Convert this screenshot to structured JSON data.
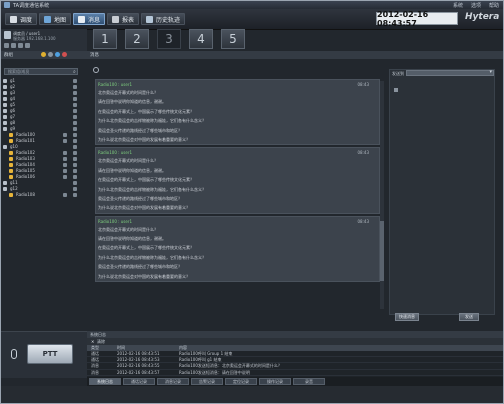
{
  "window": {
    "title": "TA调度通信系统",
    "controls": [
      "系统",
      "选项",
      "帮助"
    ]
  },
  "toolbar": {
    "buttons": [
      {
        "label": "调度"
      },
      {
        "label": "地图"
      },
      {
        "label": "消息"
      },
      {
        "label": "报表"
      },
      {
        "label": "历史轨迹"
      }
    ],
    "clock": "2012-02-16 08:43:57",
    "logo": "Hytera"
  },
  "user": {
    "line1": "调度员 / user1",
    "line2": "服务器 192.168.1.100"
  },
  "numtabs": [
    "1",
    "2",
    "3",
    "4",
    "5"
  ],
  "left": {
    "group_label": "群组",
    "search_placeholder": "搜索组/成员",
    "tree": [
      {
        "label": "g1",
        "depth": 0
      },
      {
        "label": "g2",
        "depth": 0
      },
      {
        "label": "g3",
        "depth": 0
      },
      {
        "label": "g4",
        "depth": 0
      },
      {
        "label": "g5",
        "depth": 0
      },
      {
        "label": "g6",
        "depth": 0
      },
      {
        "label": "g7",
        "depth": 0
      },
      {
        "label": "g8",
        "depth": 0
      },
      {
        "label": "g9",
        "depth": 0
      },
      {
        "label": "Radio100",
        "depth": 1
      },
      {
        "label": "Radio101",
        "depth": 1
      },
      {
        "label": "g10",
        "depth": 0
      },
      {
        "label": "Radio102",
        "depth": 1
      },
      {
        "label": "Radio103",
        "depth": 1
      },
      {
        "label": "Radio104",
        "depth": 1
      },
      {
        "label": "Radio105",
        "depth": 1
      },
      {
        "label": "Radio106",
        "depth": 1
      },
      {
        "label": "g11",
        "depth": 0
      },
      {
        "label": "g12",
        "depth": 0
      },
      {
        "label": "Radio108",
        "depth": 1
      }
    ],
    "ptt": "PTT"
  },
  "main": {
    "header": "消息",
    "messages": [
      {
        "from": "Radio100 : user1",
        "time": "08:43",
        "lines": [
          "北京奥运会开幕式的时间是什么？",
          "请在回答中说明你知道的信息，谢谢。",
          "在奥运会的开幕式上，中国展示了哪些传统文化元素？",
          "为什么北京奥运会的吉祥物被称为福娃，它们各有什么含义？",
          "奥运会圣火传递的路线经过了哪些城市和地区？",
          "为什么说北京奥运会对中国的发展有着重要的意义？"
        ]
      },
      {
        "from": "Radio100 : user1",
        "time": "08:43",
        "lines": [
          "北京奥运会开幕式的时间是什么？",
          "请在回答中说明你知道的信息，谢谢。",
          "在奥运会的开幕式上，中国展示了哪些传统文化元素？",
          "为什么北京奥运会的吉祥物被称为福娃，它们各有什么含义？",
          "奥运会圣火传递的路线经过了哪些城市和地区？",
          "为什么说北京奥运会对中国的发展有着重要的意义？"
        ]
      },
      {
        "from": "Radio100 : user1",
        "time": "08:43",
        "lines": [
          "北京奥运会开幕式的时间是什么？",
          "请在回答中说明你知道的信息，谢谢。",
          "在奥运会的开幕式上，中国展示了哪些传统文化元素？",
          "为什么北京奥运会的吉祥物被称为福娃，它们各有什么含义？",
          "奥运会圣火传递的路线经过了哪些城市和地区？",
          "为什么说北京奥运会对中国的发展有着重要的意义？"
        ]
      }
    ],
    "right_label": "发送到",
    "btn_quick": "快速消息",
    "btn_send": "发送"
  },
  "log": {
    "header": "系统日志",
    "clear": "清除",
    "columns": [
      "类型",
      "时间",
      "内容"
    ],
    "rows": [
      {
        "type": "通话",
        "time": "2012-02-16 08:43:51",
        "content": "Radio100呼叫 Group 1 结束"
      },
      {
        "type": "通话",
        "time": "2012-02-16 08:43:53",
        "content": "Radio100呼叫 g1 结束"
      },
      {
        "type": "消息",
        "time": "2012-02-16 08:43:55",
        "content": "Radio100发送短消息：北京奥运会开幕式的时间是什么？"
      },
      {
        "type": "消息",
        "time": "2012-02-16 08:43:57",
        "content": "Radio100发送短消息：请在回答中说明"
      }
    ],
    "tabs": [
      "系统日志",
      "通话记录",
      "消息记录",
      "告警记录",
      "定位记录",
      "操作记录",
      "录音"
    ]
  }
}
